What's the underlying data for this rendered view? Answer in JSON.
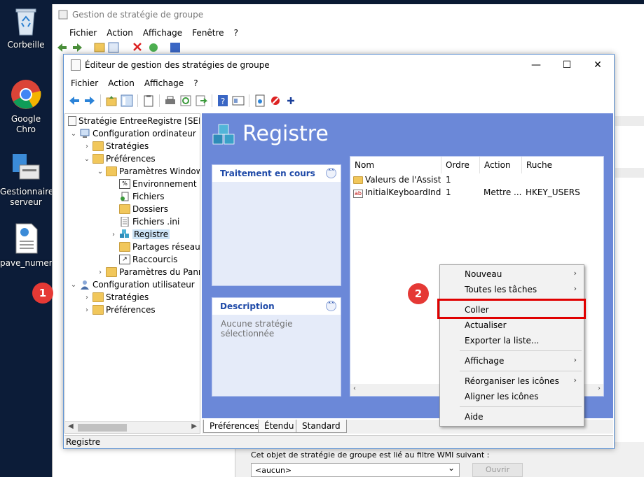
{
  "desktop": {
    "icons": [
      {
        "label": "Corbeille"
      },
      {
        "label": "Google Chro"
      },
      {
        "label_line1": "Gestionnaire",
        "label_line2": "serveur"
      },
      {
        "label": "pave_numeric"
      }
    ]
  },
  "bg_window": {
    "title": "Gestion de stratégie de groupe",
    "menu": [
      "Fichier",
      "Action",
      "Affichage",
      "Fenêtre",
      "?"
    ],
    "wmi_label": "Cet objet de stratégie de groupe est lié au filtre WMI suivant :",
    "wmi_value": "<aucun>",
    "open_button": "Ouvrir"
  },
  "editor": {
    "title": "Éditeur de gestion des stratégies de groupe",
    "menu": [
      "Fichier",
      "Action",
      "Affichage",
      "?"
    ],
    "tree": {
      "root": "Stratégie EntreeRegistre [SERVEU",
      "computer_config": "Configuration ordinateur",
      "strategies": "Stratégies",
      "preferences": "Préférences",
      "windows_settings": "Paramètres Windows",
      "environment": "Environnement",
      "files": "Fichiers",
      "folders": "Dossiers",
      "ini_files": "Fichiers .ini",
      "registry": "Registre",
      "network_shares": "Partages réseau",
      "shortcuts": "Raccourcis",
      "control_panel": "Paramètres du Panne",
      "user_config": "Configuration utilisateur",
      "user_strategies": "Stratégies",
      "user_preferences": "Préférences"
    },
    "pane_title": "Registre",
    "processing_box": {
      "title": "Traitement en cours"
    },
    "description_box": {
      "title": "Description",
      "text": "Aucune stratégie sélectionnée"
    },
    "list": {
      "columns": [
        "Nom",
        "Ordre",
        "Action",
        "Ruche"
      ],
      "rows": [
        {
          "name": "Valeurs de l'Assist...",
          "order": "1",
          "action": "",
          "hive": ""
        },
        {
          "name": "InitialKeyboardInd...",
          "order": "1",
          "action": "Mettre ...",
          "hive": "HKEY_USERS"
        }
      ]
    },
    "tabs": [
      "Préférences",
      "Étendu",
      "Standard"
    ],
    "status": "Registre"
  },
  "context_menu": {
    "items": {
      "new": "Nouveau",
      "all_tasks": "Toutes les tâches",
      "paste": "Coller",
      "refresh": "Actualiser",
      "export": "Exporter la liste...",
      "view": "Affichage",
      "arrange": "Réorganiser les icônes",
      "align": "Aligner les icônes",
      "help": "Aide"
    }
  },
  "annotations": {
    "badge1": "1",
    "badge2": "2",
    "highlight_color": "#e00000"
  },
  "colors": {
    "pane_bg": "#6b88d8",
    "box_title": "#1f4aa8"
  }
}
